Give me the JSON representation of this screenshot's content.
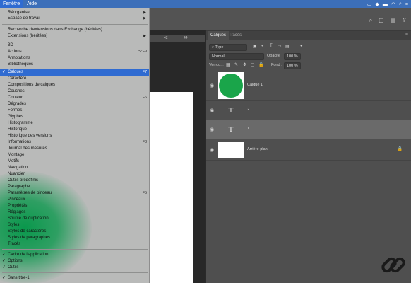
{
  "menubar": {
    "active_menu": "Fenêtre",
    "next_menu": "Aide"
  },
  "menu": {
    "items": [
      {
        "label": "Réorganiser",
        "submenu": true
      },
      {
        "label": "Espace de travail",
        "submenu": true
      },
      {
        "label": "Recherche d'extensions dans Exchange (héritées)...",
        "submenu": false
      },
      {
        "label": "Extensions (héritées)",
        "submenu": true
      },
      {
        "label": "3D"
      },
      {
        "label": "Actions",
        "shortcut": "⌥F9"
      },
      {
        "label": "Annotations"
      },
      {
        "label": "Bibliothèques"
      },
      {
        "label": "Calques",
        "shortcut": "F7",
        "checked": true,
        "highlighted": true
      },
      {
        "label": "Caractère"
      },
      {
        "label": "Compositions de calques"
      },
      {
        "label": "Couches"
      },
      {
        "label": "Couleur",
        "shortcut": "F6"
      },
      {
        "label": "Dégradés"
      },
      {
        "label": "Formes"
      },
      {
        "label": "Glyphes"
      },
      {
        "label": "Histogramme"
      },
      {
        "label": "Historique"
      },
      {
        "label": "Historique des versions"
      },
      {
        "label": "Informations",
        "shortcut": "F8"
      },
      {
        "label": "Journal des mesures"
      },
      {
        "label": "Montage"
      },
      {
        "label": "Motifs"
      },
      {
        "label": "Navigation"
      },
      {
        "label": "Nuancier"
      },
      {
        "label": "Outils prédéfinis"
      },
      {
        "label": "Paragraphe"
      },
      {
        "label": "Paramètres de pinceau",
        "shortcut": "F5"
      },
      {
        "label": "Pinceaux"
      },
      {
        "label": "Propriétés"
      },
      {
        "label": "Réglages"
      },
      {
        "label": "Source de duplication"
      },
      {
        "label": "Styles"
      },
      {
        "label": "Styles de caractères"
      },
      {
        "label": "Styles de paragraphes"
      },
      {
        "label": "Tracés"
      },
      {
        "label": "Cadre de l'application",
        "checked": true
      },
      {
        "label": "Options",
        "checked": true
      },
      {
        "label": "Outils",
        "checked": true
      },
      {
        "label": "Sans titre-1",
        "checked": true
      }
    ]
  },
  "ruler": {
    "ticks": [
      "42",
      "44"
    ]
  },
  "panel": {
    "tabs": [
      "Calques",
      "Tracés"
    ],
    "filter_value": "Type",
    "blend_mode": "Normal",
    "opacity_label": "Opacité :",
    "opacity_value": "100 %",
    "lock_label": "Verrou. :",
    "fill_label": "Fond :",
    "fill_value": "100 %",
    "layers": [
      {
        "name": "Calque 1",
        "thumb": "green-circle"
      },
      {
        "name": "2",
        "thumb": "text"
      },
      {
        "name": "1",
        "thumb": "text-box",
        "selected": true
      },
      {
        "name": "Arrière-plan",
        "thumb": "white",
        "locked": true
      }
    ]
  },
  "colors": {
    "menubar": "#3c6fb9",
    "menu_highlight": "#2f6bd1",
    "layer_green": "#1aa54a"
  },
  "icons": {
    "status": [
      "camera-icon",
      "dropbox-icon",
      "battery-icon",
      "wifi-icon",
      "search-icon",
      "control-center-icon"
    ],
    "watermark": "chain-link-logo"
  }
}
